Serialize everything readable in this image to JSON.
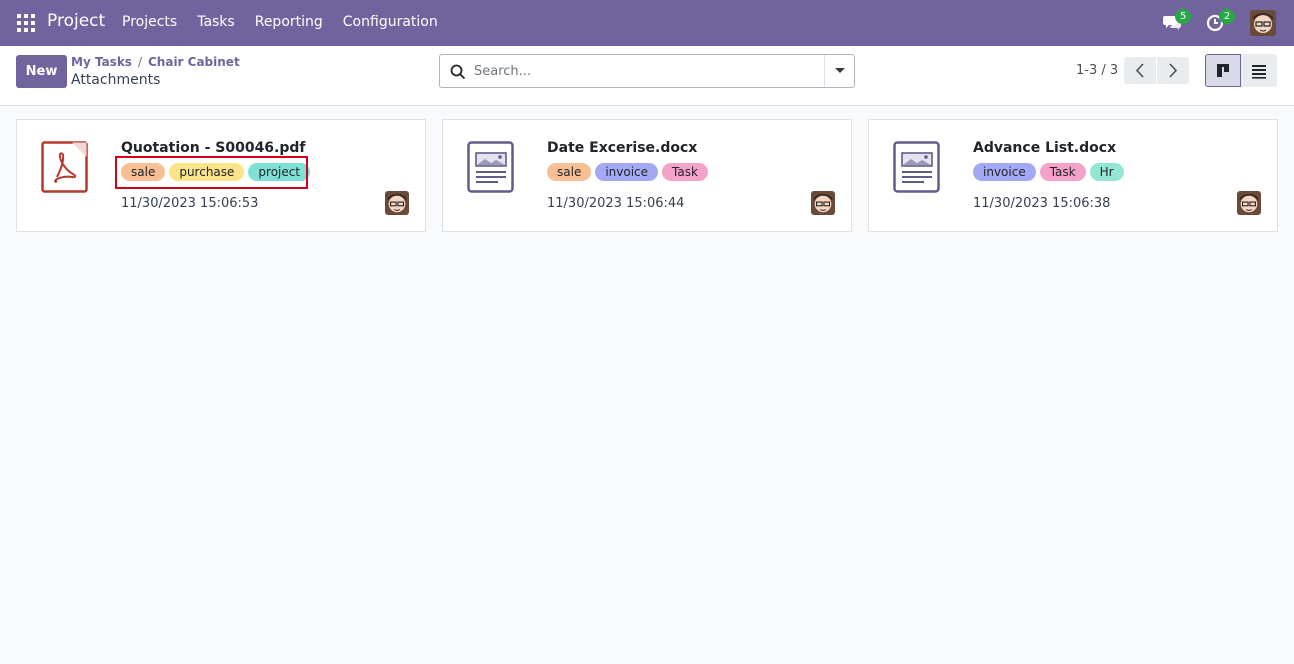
{
  "app": {
    "brand": "Project"
  },
  "menu": [
    "Projects",
    "Tasks",
    "Reporting",
    "Configuration"
  ],
  "systray": {
    "messages_count": "5",
    "activities_count": "2"
  },
  "control": {
    "new_label": "New",
    "breadcrumb": [
      "My Tasks",
      "Chair Cabinet"
    ],
    "current": "Attachments",
    "search_placeholder": "Search...",
    "pager": "1-3 / 3"
  },
  "colors": {
    "brand": "#71639e",
    "tag_sale": "#f7bf93",
    "tag_purchase": "#fbe38a",
    "tag_project": "#7fe0d6",
    "tag_invoice": "#a3a9f5",
    "tag_task": "#f4a2c9",
    "tag_hr": "#93e6d4"
  },
  "cards": [
    {
      "title": "Quotation - S00046.pdf",
      "icon": "pdf-icon",
      "tags": [
        {
          "label": "sale"
        },
        {
          "label": "purchase"
        },
        {
          "label": "project"
        }
      ],
      "date": "11/30/2023 15:06:53"
    },
    {
      "title": "Date Excerise.docx",
      "icon": "document-icon",
      "tags": [
        {
          "label": "sale"
        },
        {
          "label": "invoice"
        },
        {
          "label": "Task"
        }
      ],
      "date": "11/30/2023 15:06:44"
    },
    {
      "title": "Advance List.docx",
      "icon": "document-icon",
      "tags": [
        {
          "label": "invoice"
        },
        {
          "label": "Task"
        },
        {
          "label": "Hr"
        }
      ],
      "date": "11/30/2023 15:06:38"
    }
  ]
}
